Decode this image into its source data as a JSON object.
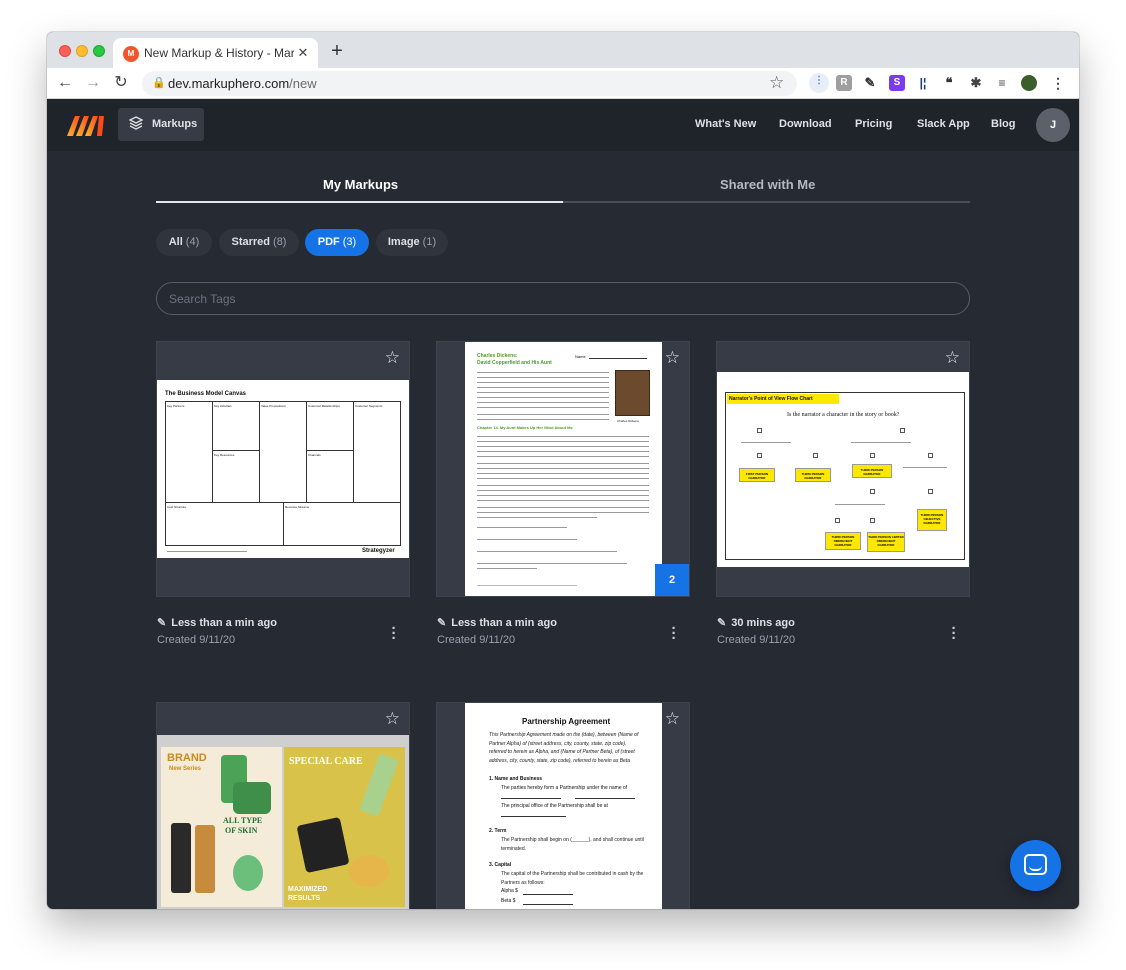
{
  "browser": {
    "tab_title": "New Markup & History - Marku",
    "tab_favicon": "M",
    "url_host": "dev.markuphero.com",
    "url_path": "/new",
    "ext_s_label": "S"
  },
  "app": {
    "markups_button": "Markups",
    "nav": [
      "What's New",
      "Download",
      "Pricing",
      "Slack App",
      "Blog"
    ],
    "avatar_initial": "J"
  },
  "tabs": {
    "my": "My Markups",
    "shared": "Shared with Me"
  },
  "filters": [
    {
      "label": "All",
      "count": "(4)"
    },
    {
      "label": "Starred",
      "count": "(8)"
    },
    {
      "label": "PDF",
      "count": "(3)"
    },
    {
      "label": "Image",
      "count": "(1)"
    }
  ],
  "search": {
    "placeholder": "Search Tags"
  },
  "cards": [
    {
      "edited": "Less than a min ago",
      "created": "Created 9/11/20",
      "thumb_title": "The Business Model Canvas",
      "cells": [
        "Key Partners",
        "Key Activities",
        "Value Propositions",
        "Customer Relationships",
        "Customer Segments",
        "Key Resources",
        "Channels",
        "Cost Structure",
        "Revenue Streams"
      ],
      "brand": "Strategyzer"
    },
    {
      "edited": "Less than a min ago",
      "created": "Created 9/11/20",
      "badge": "2",
      "thumb_title": "Charles Dickens:",
      "thumb_subtitle": "David Copperfield and His Aunt",
      "thumb_name": "Name",
      "thumb_chapter": "Chapter 14. My Aunt Makes Up Her Mind About Me",
      "thumb_caption": "Charles Dickens"
    },
    {
      "edited": "30 mins ago",
      "created": "Created 9/11/20",
      "thumb_title": "Narrator's Point of View Flow Chart",
      "thumb_question": "Is the narrator a character in the story or book?",
      "flow_boxes": [
        "FIRST PERSON NARRATOR",
        "THIRD PERSON NARRATOR",
        "THIRD PERSON NARRATOR",
        "THIRD PERSON OMNISCIENT NARRATOR",
        "THIRD PERSON LIMITED OMNISCIENT NARRATOR",
        "THIRD PERSON OBJECTIVE NARRATOR"
      ]
    },
    {
      "brand_title": "BRAND",
      "brand_sub": "New Series",
      "special": "SPECIAL CARE",
      "all_type": "ALL TYPE",
      "of_skin": "OF SKIN",
      "maximized": "MAXIMIZED",
      "results": "RESULTS"
    },
    {
      "thumb_title": "Partnership Agreement",
      "intro": "This Partnership Agreement made on the (date), between (Name of Partner Alpha) of (street address, city, county, state, zip code), referred to herein as Alpha, and (Name of Partner Beta), of (street address, city, county, state, zip code), referred to herein as Beta",
      "s1": "1.  Name and Business",
      "s1_text": "The parties hereby form a Partnership under the name of",
      "s1_text2": "The principal office of the Partnership shall be at",
      "s2": "2.  Term",
      "s2_text": "The Partnership shall begin on (______), and shall continue until terminated.",
      "s3": "3.  Capital",
      "s3_text": "The capital of the Partnership shall be contributed in cash by the Partners as follows:",
      "alpha": "Alpha    $",
      "beta": "Beta     $"
    }
  ],
  "colors": {
    "accent": "#1673e6",
    "bg": "#262a33",
    "header": "#1f232a",
    "card": "#363b45"
  }
}
